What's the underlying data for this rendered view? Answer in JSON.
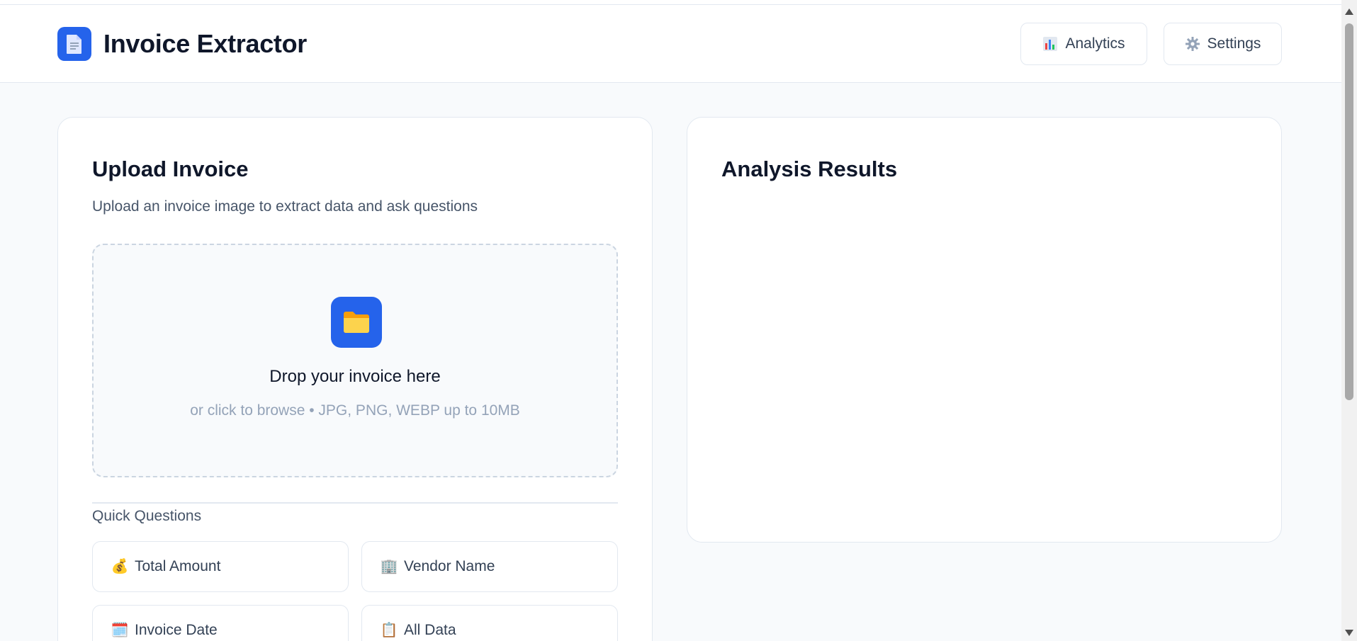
{
  "app": {
    "title": "Invoice Extractor",
    "logo_icon": "document-icon",
    "accent_color": "#2563eb"
  },
  "header": {
    "buttons": [
      {
        "label": "Analytics",
        "icon": "bar-chart-icon"
      },
      {
        "label": "Settings",
        "icon": "gear-icon"
      }
    ]
  },
  "upload": {
    "title": "Upload Invoice",
    "subtitle": "Upload an invoice image to extract data and ask questions",
    "dropzone": {
      "icon": "folder-icon",
      "title": "Drop your invoice here",
      "subtitle": "or click to browse • JPG, PNG, WEBP up to 10MB"
    },
    "quick_questions": {
      "label": "Quick Questions",
      "items": [
        {
          "label": "Total Amount",
          "icon": "money-bag-icon",
          "emoji": "💰"
        },
        {
          "label": "Vendor Name",
          "icon": "building-icon",
          "emoji": "🏢"
        },
        {
          "label": "Invoice Date",
          "icon": "calendar-icon",
          "emoji": "🗓️"
        },
        {
          "label": "All Data",
          "icon": "clipboard-icon",
          "emoji": "📋"
        }
      ]
    }
  },
  "results": {
    "title": "Analysis Results"
  }
}
